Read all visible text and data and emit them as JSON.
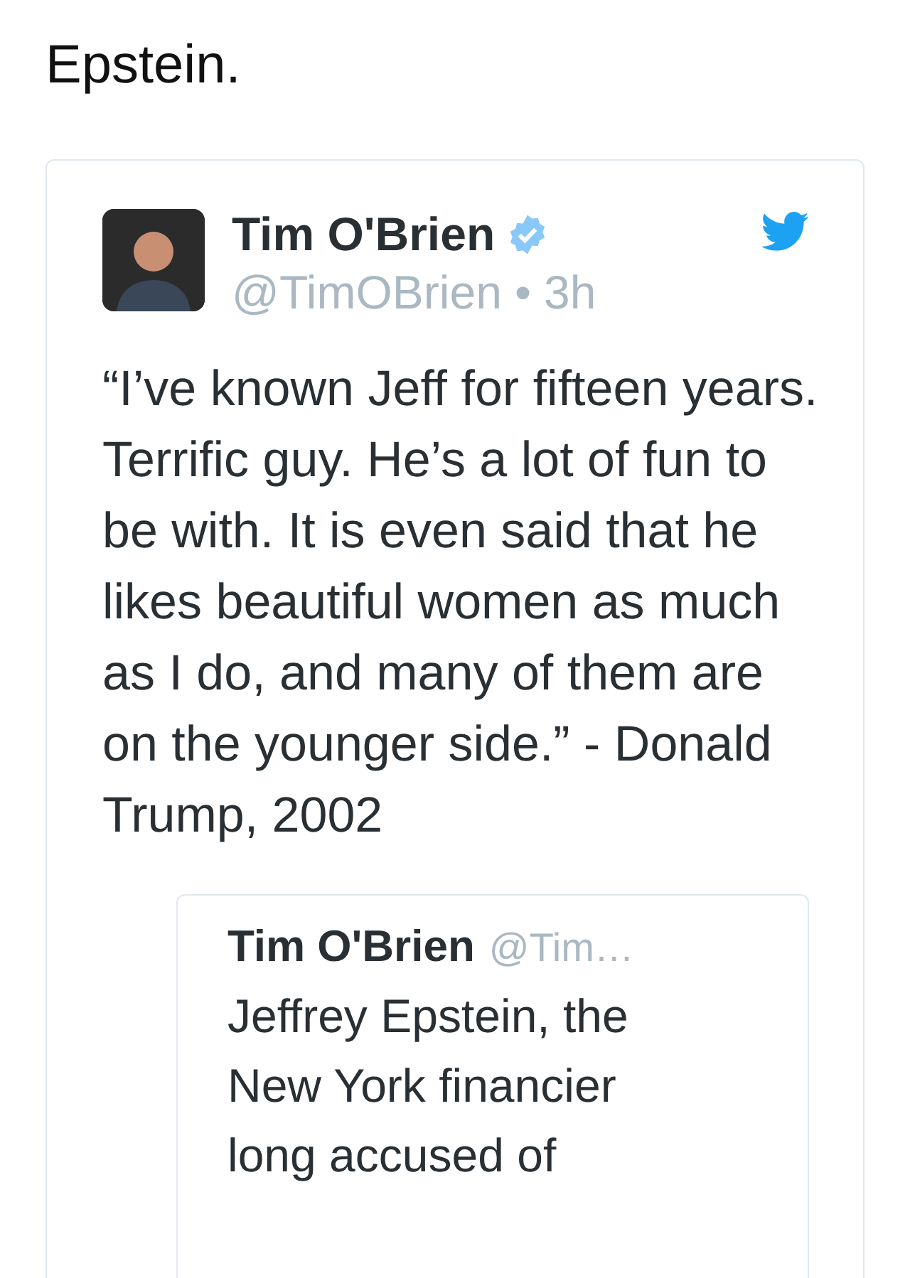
{
  "heading": "Epstein.",
  "tweet": {
    "name": "Tim O'Brien",
    "verified": true,
    "handle": "@TimOBrien",
    "separator": "•",
    "time": "3h",
    "text": "“I’ve known Jeff for fifteen years. Terrific guy. He’s a lot of fun to be with. It is even said that he likes beautiful women as much as I do, and many of them are on the younger side.” - Donald Trump, 2002",
    "quoted_tweet": {
      "name": "Tim O'Brien",
      "handle": "@Tim…",
      "text": "Jeffrey Epstein, the New York financier long accused of"
    }
  }
}
